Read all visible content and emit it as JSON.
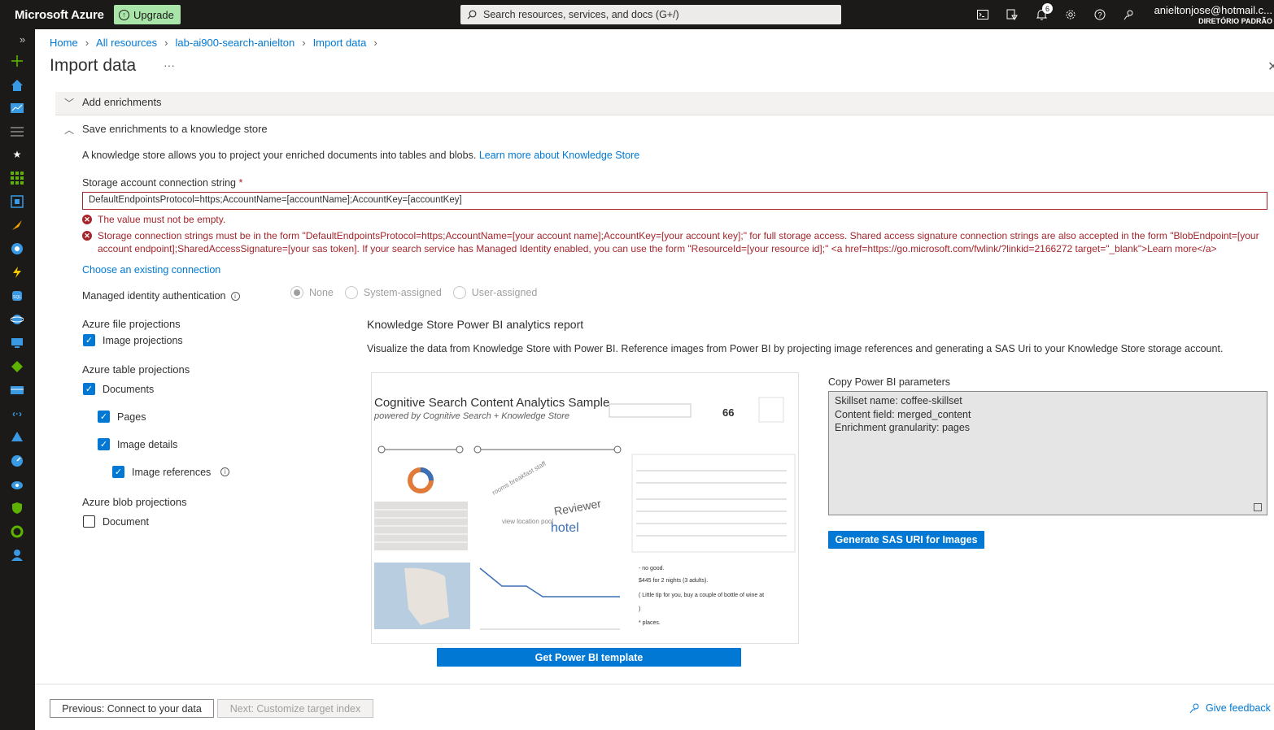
{
  "topbar": {
    "brand": "Microsoft Azure",
    "upgrade_label": "Upgrade",
    "search_placeholder": "Search resources, services, and docs (G+/)",
    "notifications_count": "6",
    "user_email": "anieltonjose@hotmail.c...",
    "user_directory": "DIRETÓRIO PADRÃO"
  },
  "breadcrumb": [
    "Home",
    "All resources",
    "lab-ai900-search-anielton",
    "Import data"
  ],
  "page": {
    "title": "Import data",
    "more": "···"
  },
  "sections": {
    "add_enrichments": "Add enrichments",
    "save_enrichments": "Save enrichments to a knowledge store"
  },
  "knowledge": {
    "description": "A knowledge store allows you to project your enriched documents into tables and blobs.",
    "learn_more": "Learn more about Knowledge Store",
    "conn_label": "Storage account connection string",
    "required_mark": "*",
    "conn_value": "DefaultEndpointsProtocol=https;AccountName=[accountName];AccountKey=[accountKey]",
    "error1": "The value must not be empty.",
    "error2": "Storage connection strings must be in the form \"DefaultEndpointsProtocol=https;AccountName=[your account name];AccountKey=[your account key];\" for full storage access. Shared access signature connection strings are also accepted in the form \"BlobEndpoint=[your account endpoint];SharedAccessSignature=[your sas token]. If your search service has Managed Identity enabled, you can use the form \"ResourceId=[your resource id];\" <a href=https://go.microsoft.com/fwlink/?linkid=2166272 target=\"_blank\">Learn more</a>",
    "choose_existing": "Choose an existing connection",
    "mia_label": "Managed identity authentication",
    "mia_options": [
      "None",
      "System-assigned",
      "User-assigned"
    ]
  },
  "projections": {
    "file_title": "Azure file projections",
    "image_projections": "Image projections",
    "table_title": "Azure table projections",
    "documents": "Documents",
    "pages": "Pages",
    "image_details": "Image details",
    "image_references": "Image references",
    "blob_title": "Azure blob projections",
    "blob_document": "Document"
  },
  "powerbi": {
    "title": "Knowledge Store Power BI analytics report",
    "description": "Visualize the data from Knowledge Store with Power BI. Reference images from Power BI by projecting image references and generating a SAS Uri to your Knowledge Store storage account.",
    "preview_title": "Cognitive Search Content Analytics Sample",
    "preview_subtitle": "powered by Cognitive Search + Knowledge Store",
    "preview_number": "66",
    "copy_label": "Copy Power BI parameters",
    "params": [
      "Skillset name: coffee-skillset",
      "Content field: merged_content",
      "Enrichment granularity: pages"
    ],
    "sas_button": "Generate SAS URI for Images",
    "template_button": "Get Power BI template"
  },
  "footer": {
    "previous": "Previous: Connect to your data",
    "next": "Next: Customize target index",
    "feedback": "Give feedback"
  },
  "colors": {
    "accent": "#0078d4",
    "error": "#a4262c",
    "topbar": "#1b1a19",
    "upgrade": "#a9e5a9"
  }
}
